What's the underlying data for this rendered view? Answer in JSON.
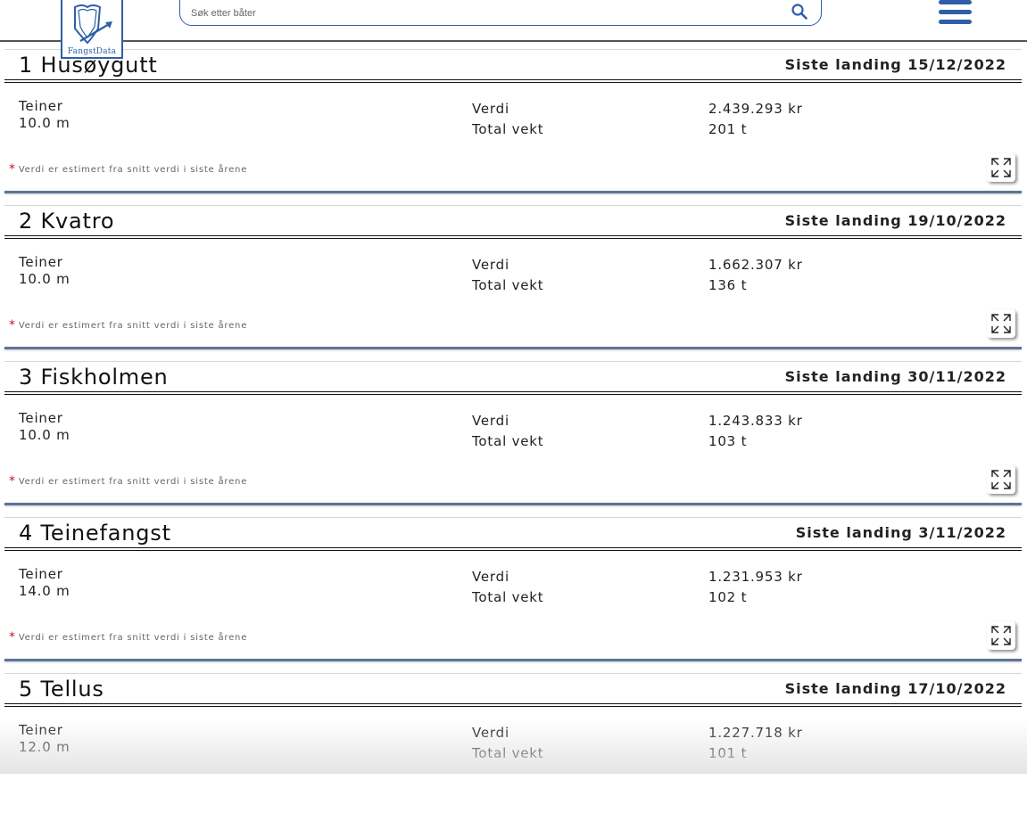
{
  "header": {
    "logo_text": "FangstData",
    "search_placeholder": "Søk etter båter"
  },
  "vessels": [
    {
      "name": "1 Husøygutt",
      "landing": "Siste landing 15/12/2022",
      "gear": "Teiner",
      "length": "10.0 m",
      "value_label": "Verdi",
      "value": "2.439.293 kr",
      "weight_label": "Total vekt",
      "weight": "201 t",
      "note_star": "*",
      "note": "Verdi er estimert fra snitt verdi i siste årene"
    },
    {
      "name": "2 Kvatro",
      "landing": "Siste landing 19/10/2022",
      "gear": "Teiner",
      "length": "10.0 m",
      "value_label": "Verdi",
      "value": "1.662.307 kr",
      "weight_label": "Total vekt",
      "weight": "136 t",
      "note_star": "*",
      "note": "Verdi er estimert fra snitt verdi i siste årene"
    },
    {
      "name": "3 Fiskholmen",
      "landing": "Siste landing 30/11/2022",
      "gear": "Teiner",
      "length": "10.0 m",
      "value_label": "Verdi",
      "value": "1.243.833 kr",
      "weight_label": "Total vekt",
      "weight": "103 t",
      "note_star": "*",
      "note": "Verdi er estimert fra snitt verdi i siste årene"
    },
    {
      "name": "4 Teinefangst",
      "landing": "Siste landing 3/11/2022",
      "gear": "Teiner",
      "length": "14.0 m",
      "value_label": "Verdi",
      "value": "1.231.953 kr",
      "weight_label": "Total vekt",
      "weight": "102 t",
      "note_star": "*",
      "note": "Verdi er estimert fra snitt verdi i siste årene"
    },
    {
      "name": "5 Tellus",
      "landing": "Siste landing 17/10/2022",
      "gear": "Teiner",
      "length": "12.0 m",
      "value_label": "Verdi",
      "value": "1.227.718 kr",
      "weight_label": "Total vekt",
      "weight": "101 t"
    }
  ]
}
